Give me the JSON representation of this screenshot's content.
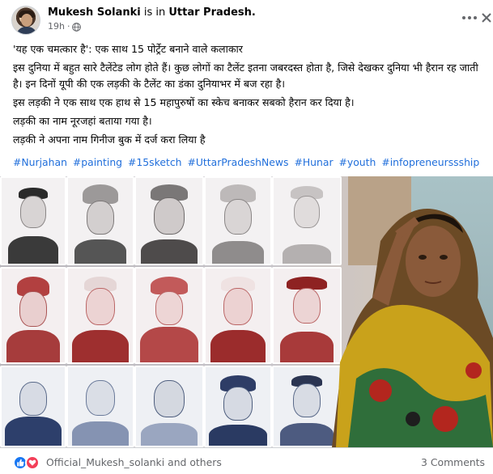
{
  "header": {
    "author_name": "Mukesh Solanki",
    "is_in_text": "is in",
    "location": "Uttar Pradesh.",
    "time_ago": "19h",
    "separator": "·"
  },
  "post": {
    "lines": [
      "'यह एक चमत्कार है': एक साथ 15 पोर्ट्रेट बनाने वाले कलाकार",
      "इस दुनिया में बहुत सारे टैलेंटेड लोग होते हैं। कुछ लोगों का टैलेंट इतना जबरदस्त होता है, जिसे देखकर दुनिया भी हैरान रह जाती है। इन दिनों यूपी की एक लड़की के टैलेंट का डंका दुनियाभर में बज रहा है।",
      "इस लड़की ने एक साथ एक हाथ से 15 महापुरुषों का स्केच बनाकर सबको हैरान कर दिया है।",
      "लड़की का नाम नूरजहां बताया गया है।",
      "लड़की ने अपना नाम गिनीज बुक में दर्ज करा लिया है"
    ],
    "hashtags": [
      "#Nurjahan",
      "#painting",
      "#15sketch",
      "#UttarPradeshNews",
      "#Hunar",
      "#youth",
      "#infopreneurssship"
    ]
  },
  "footer": {
    "reactors_text": "Official_Mukesh_solanki and others",
    "comments_text": "3 Comments"
  },
  "colors": {
    "link": "#216fdb",
    "meta": "#65676b",
    "like": "#1877f2",
    "love": "#f33e58"
  },
  "icons": {
    "more": "more-horizontal-icon",
    "close": "close-icon",
    "privacy": "globe-icon",
    "like_reaction": "like-icon",
    "love_reaction": "love-icon"
  }
}
